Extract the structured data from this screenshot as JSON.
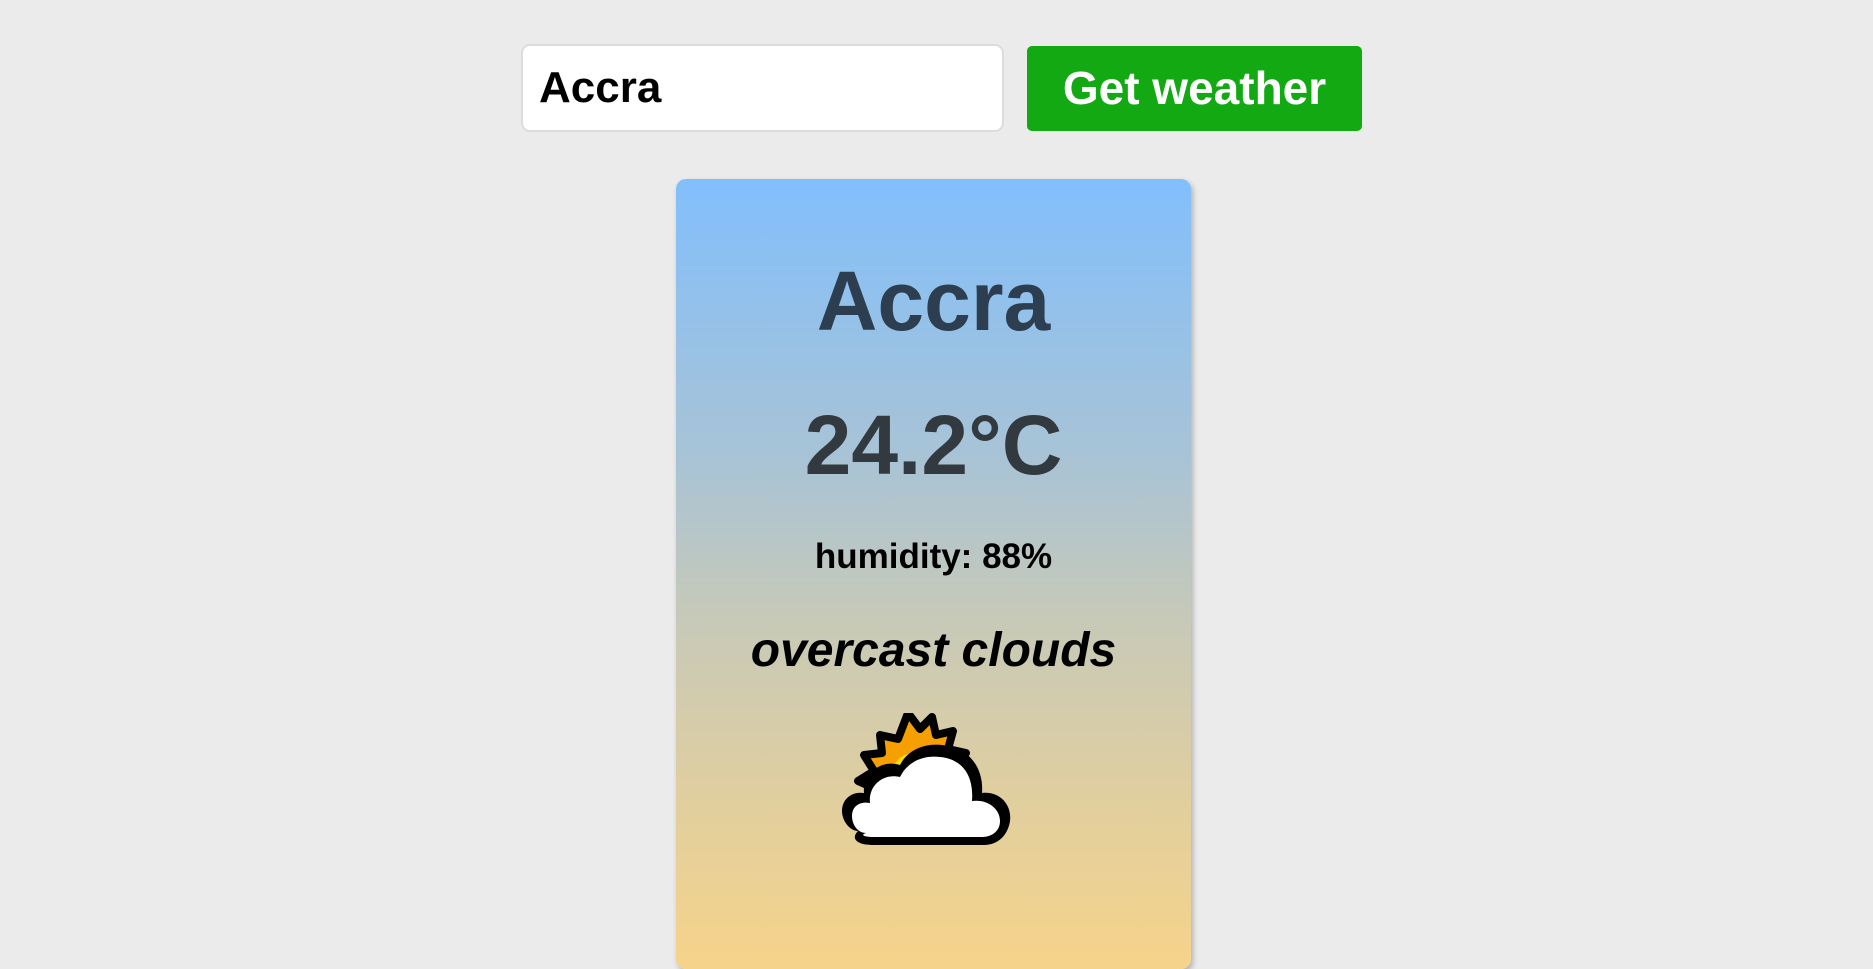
{
  "search": {
    "value": "Accra",
    "button_label": "Get weather"
  },
  "card": {
    "city": "Accra",
    "temperature": "24.2°C",
    "humidity": "humidity: 88%",
    "description": "overcast clouds",
    "icon": "partly-cloudy-sun-icon"
  },
  "colors": {
    "background": "#ebebeb",
    "button": "#12a912",
    "card_top": "#81bffc",
    "card_bottom": "#f6d38a",
    "city_text": "#2c3e50"
  }
}
